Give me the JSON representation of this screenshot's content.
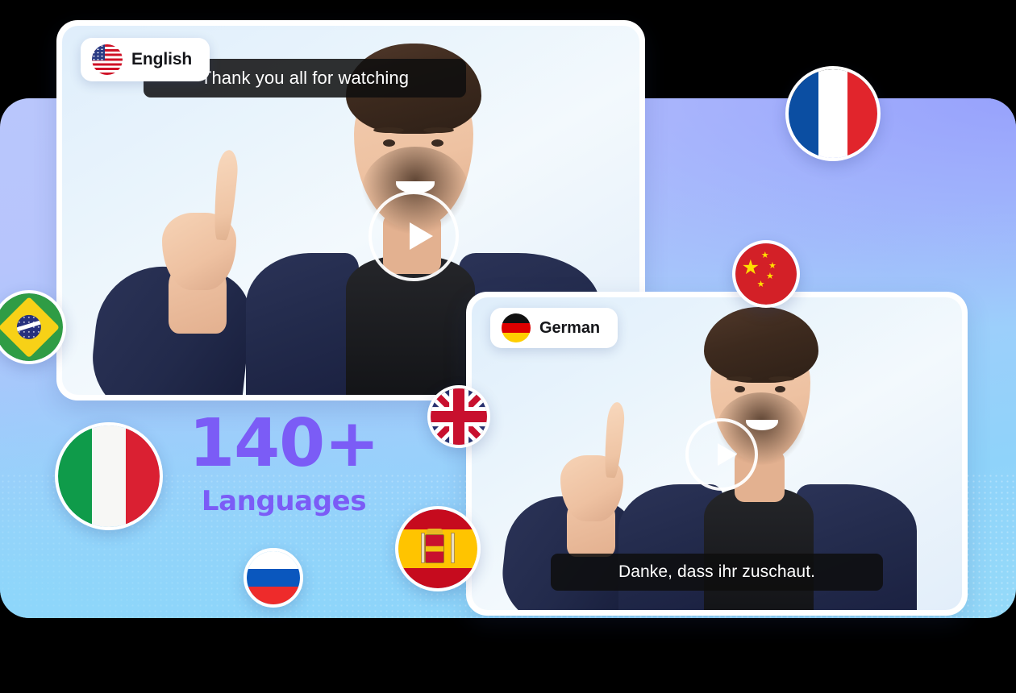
{
  "theme": {
    "accent_purple": "#7B5CF6",
    "background_gradient_from": "#B9C6FC",
    "background_gradient_to": "#95DAF9",
    "card_surface": "#FFFFFF",
    "subtitle_bar": "#0E0E0E",
    "subtitle_text": "#FFFFFF"
  },
  "stat": {
    "number": "140+",
    "label": "Languages"
  },
  "cards": [
    {
      "id": "english",
      "badge_label": "English",
      "badge_flag": "us-flag-icon",
      "subtitle": "Thank you all for watching",
      "play_button": "play-icon"
    },
    {
      "id": "german",
      "badge_label": "German",
      "badge_flag": "de-flag-icon",
      "subtitle": "Danke, dass ihr zuschaut.",
      "play_button": "play-icon"
    }
  ],
  "flags": [
    {
      "name": "brazil-flag-icon",
      "country": "Brazil"
    },
    {
      "name": "france-flag-icon",
      "country": "France"
    },
    {
      "name": "china-flag-icon",
      "country": "China"
    },
    {
      "name": "uk-flag-icon",
      "country": "United Kingdom"
    },
    {
      "name": "italy-flag-icon",
      "country": "Italy"
    },
    {
      "name": "spain-flag-icon",
      "country": "Spain"
    },
    {
      "name": "russia-flag-icon",
      "country": "Russia"
    }
  ]
}
